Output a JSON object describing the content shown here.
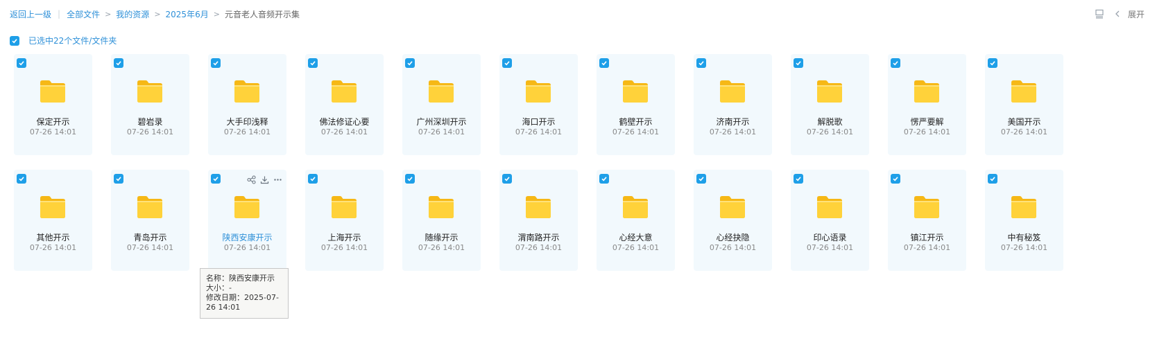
{
  "breadcrumb": {
    "back": "返回上一级",
    "items": [
      "全部文件",
      "我的资源",
      "2025年6月"
    ],
    "current": "元音老人音频开示集"
  },
  "toolbar": {
    "expand_label": "展开"
  },
  "selection": {
    "label": "已选中22个文件/文件夹"
  },
  "folders": [
    {
      "name": "保定开示",
      "date": "07-26 14:01"
    },
    {
      "name": "碧岩录",
      "date": "07-26 14:01"
    },
    {
      "name": "大手印浅释",
      "date": "07-26 14:01"
    },
    {
      "name": "佛法修证心要",
      "date": "07-26 14:01"
    },
    {
      "name": "广州深圳开示",
      "date": "07-26 14:01"
    },
    {
      "name": "海口开示",
      "date": "07-26 14:01"
    },
    {
      "name": "鹤壁开示",
      "date": "07-26 14:01"
    },
    {
      "name": "济南开示",
      "date": "07-26 14:01"
    },
    {
      "name": "解脱歌",
      "date": "07-26 14:01"
    },
    {
      "name": "愣严要解",
      "date": "07-26 14:01"
    },
    {
      "name": "美国开示",
      "date": "07-26 14:01"
    },
    {
      "name": "其他开示",
      "date": "07-26 14:01"
    },
    {
      "name": "青岛开示",
      "date": "07-26 14:01"
    },
    {
      "name": "陕西安康开示",
      "date": "07-26 14:01"
    },
    {
      "name": "上海开示",
      "date": "07-26 14:01"
    },
    {
      "name": "随缘开示",
      "date": "07-26 14:01"
    },
    {
      "name": "渭南路开示",
      "date": "07-26 14:01"
    },
    {
      "name": "心经大意",
      "date": "07-26 14:01"
    },
    {
      "name": "心经抉隐",
      "date": "07-26 14:01"
    },
    {
      "name": "印心语录",
      "date": "07-26 14:01"
    },
    {
      "name": "镇江开示",
      "date": "07-26 14:01"
    },
    {
      "name": "中有秘笈",
      "date": "07-26 14:01"
    }
  ],
  "hovered_index": 13,
  "tooltip": {
    "name_line": "名称：陕西安康开示",
    "size_line": "大小：-",
    "date_line": "修改日期：2025-07-26 14:01"
  },
  "colors": {
    "accent": "#1e9fe8",
    "link": "#2e90d8",
    "card_bg": "#f2f9fd",
    "folder_front": "#ffd23a",
    "folder_back": "#f6b816"
  }
}
